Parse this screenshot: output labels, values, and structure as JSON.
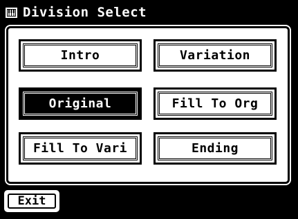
{
  "window": {
    "title": "Division Select",
    "icon": "keyboard-icon"
  },
  "divisions": [
    {
      "label": "Intro",
      "selected": false
    },
    {
      "label": "Variation",
      "selected": false
    },
    {
      "label": "Original",
      "selected": true
    },
    {
      "label": "Fill To Org",
      "selected": false
    },
    {
      "label": "Fill To Vari",
      "selected": false
    },
    {
      "label": "Ending",
      "selected": false
    }
  ],
  "footer": {
    "exit_label": "Exit"
  },
  "colors": {
    "background": "#000000",
    "panel": "#ffffff",
    "selected_button": "#000000"
  }
}
